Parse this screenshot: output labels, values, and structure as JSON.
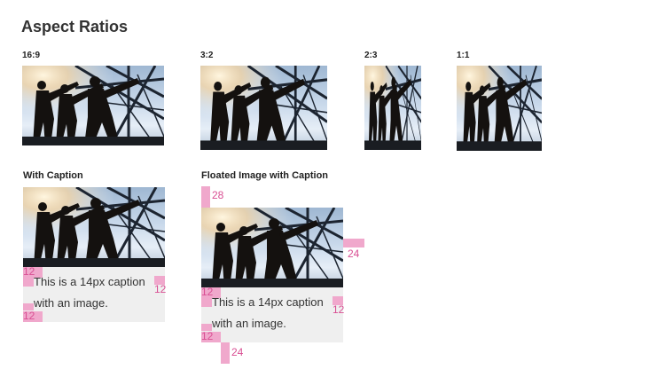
{
  "page_title": "Aspect Ratios",
  "ratios": [
    {
      "label": "16:9"
    },
    {
      "label": "3:2"
    },
    {
      "label": "2:3"
    },
    {
      "label": "1:1"
    }
  ],
  "sections": {
    "with_caption": {
      "label": "With Caption",
      "caption_line1": "This is a 14px caption",
      "caption_line2": "with an image.",
      "spacing": {
        "pad_top": "12",
        "pad_right": "12",
        "pad_bottom": "12"
      }
    },
    "floated": {
      "label": "Floated Image with Caption",
      "caption_line1": "This is a 14px caption",
      "caption_line2": "with an image.",
      "spacing": {
        "top": "28",
        "right": "24",
        "pad_top": "12",
        "pad_right": "12",
        "pad_bottom": "12",
        "bottom": "24"
      }
    }
  },
  "colors": {
    "marker": "#f0a8cc",
    "marker_text": "#d94f93",
    "caption_bg": "#efefef"
  }
}
